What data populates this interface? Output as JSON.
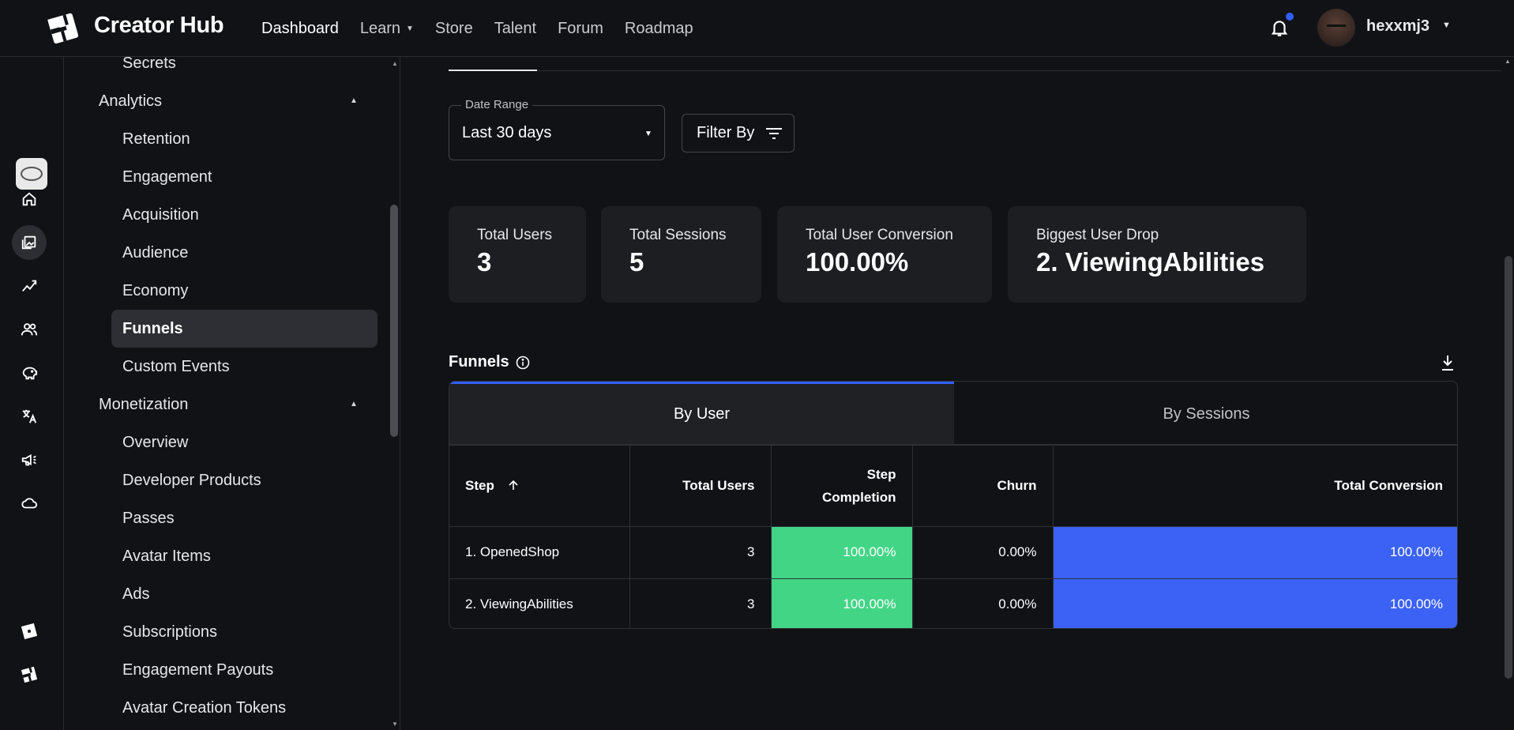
{
  "header": {
    "brand": "Creator Hub",
    "nav": [
      {
        "label": "Dashboard",
        "active": true
      },
      {
        "label": "Learn",
        "dropdown": true
      },
      {
        "label": "Store"
      },
      {
        "label": "Talent"
      },
      {
        "label": "Forum"
      },
      {
        "label": "Roadmap"
      }
    ],
    "username": "hexxmj3",
    "notification_dot_color": "#335fff"
  },
  "rail": {
    "icons": [
      "home-icon",
      "images-icon",
      "analytics-icon",
      "people-icon",
      "piggy-bank-icon",
      "translate-icon",
      "megaphone-icon",
      "cloud-icon",
      "roblox-logo-icon",
      "creator-hub-logo-icon"
    ]
  },
  "sidemenu": {
    "top_item": "Secrets",
    "analytics": {
      "label": "Analytics",
      "items": [
        "Retention",
        "Engagement",
        "Acquisition",
        "Audience",
        "Economy",
        "Funnels",
        "Custom Events"
      ],
      "active": "Funnels"
    },
    "monetization": {
      "label": "Monetization",
      "items": [
        "Overview",
        "Developer Products",
        "Passes",
        "Avatar Items",
        "Ads",
        "Subscriptions",
        "Engagement Payouts",
        "Avatar Creation Tokens"
      ]
    }
  },
  "filters": {
    "date_range_label": "Date Range",
    "date_range_value": "Last 30 days",
    "filter_by": "Filter By"
  },
  "kpis": [
    {
      "label": "Total Users",
      "value": "3"
    },
    {
      "label": "Total Sessions",
      "value": "5"
    },
    {
      "label": "Total User Conversion",
      "value": "100.00%"
    },
    {
      "label": "Biggest User Drop",
      "value": "2. ViewingAbilities"
    }
  ],
  "funnels": {
    "title": "Funnels",
    "tabs": [
      "By User",
      "By Sessions"
    ],
    "active_tab": "By User",
    "columns": {
      "step": "Step",
      "total_users": "Total Users",
      "step_completion_1": "Step",
      "step_completion_2": "Completion",
      "churn": "Churn",
      "total_conversion": "Total Conversion"
    },
    "rows": [
      {
        "step": "1. OpenedShop",
        "total_users": "3",
        "step_completion": "100.00%",
        "churn": "0.00%",
        "total_conversion": "100.00%"
      },
      {
        "step": "2. ViewingAbilities",
        "total_users": "3",
        "step_completion": "100.00%",
        "churn": "0.00%",
        "total_conversion": "100.00%"
      }
    ],
    "colors": {
      "completion": "#43d586",
      "conversion": "#3b62f5",
      "tab_accent": "#335fff"
    }
  }
}
